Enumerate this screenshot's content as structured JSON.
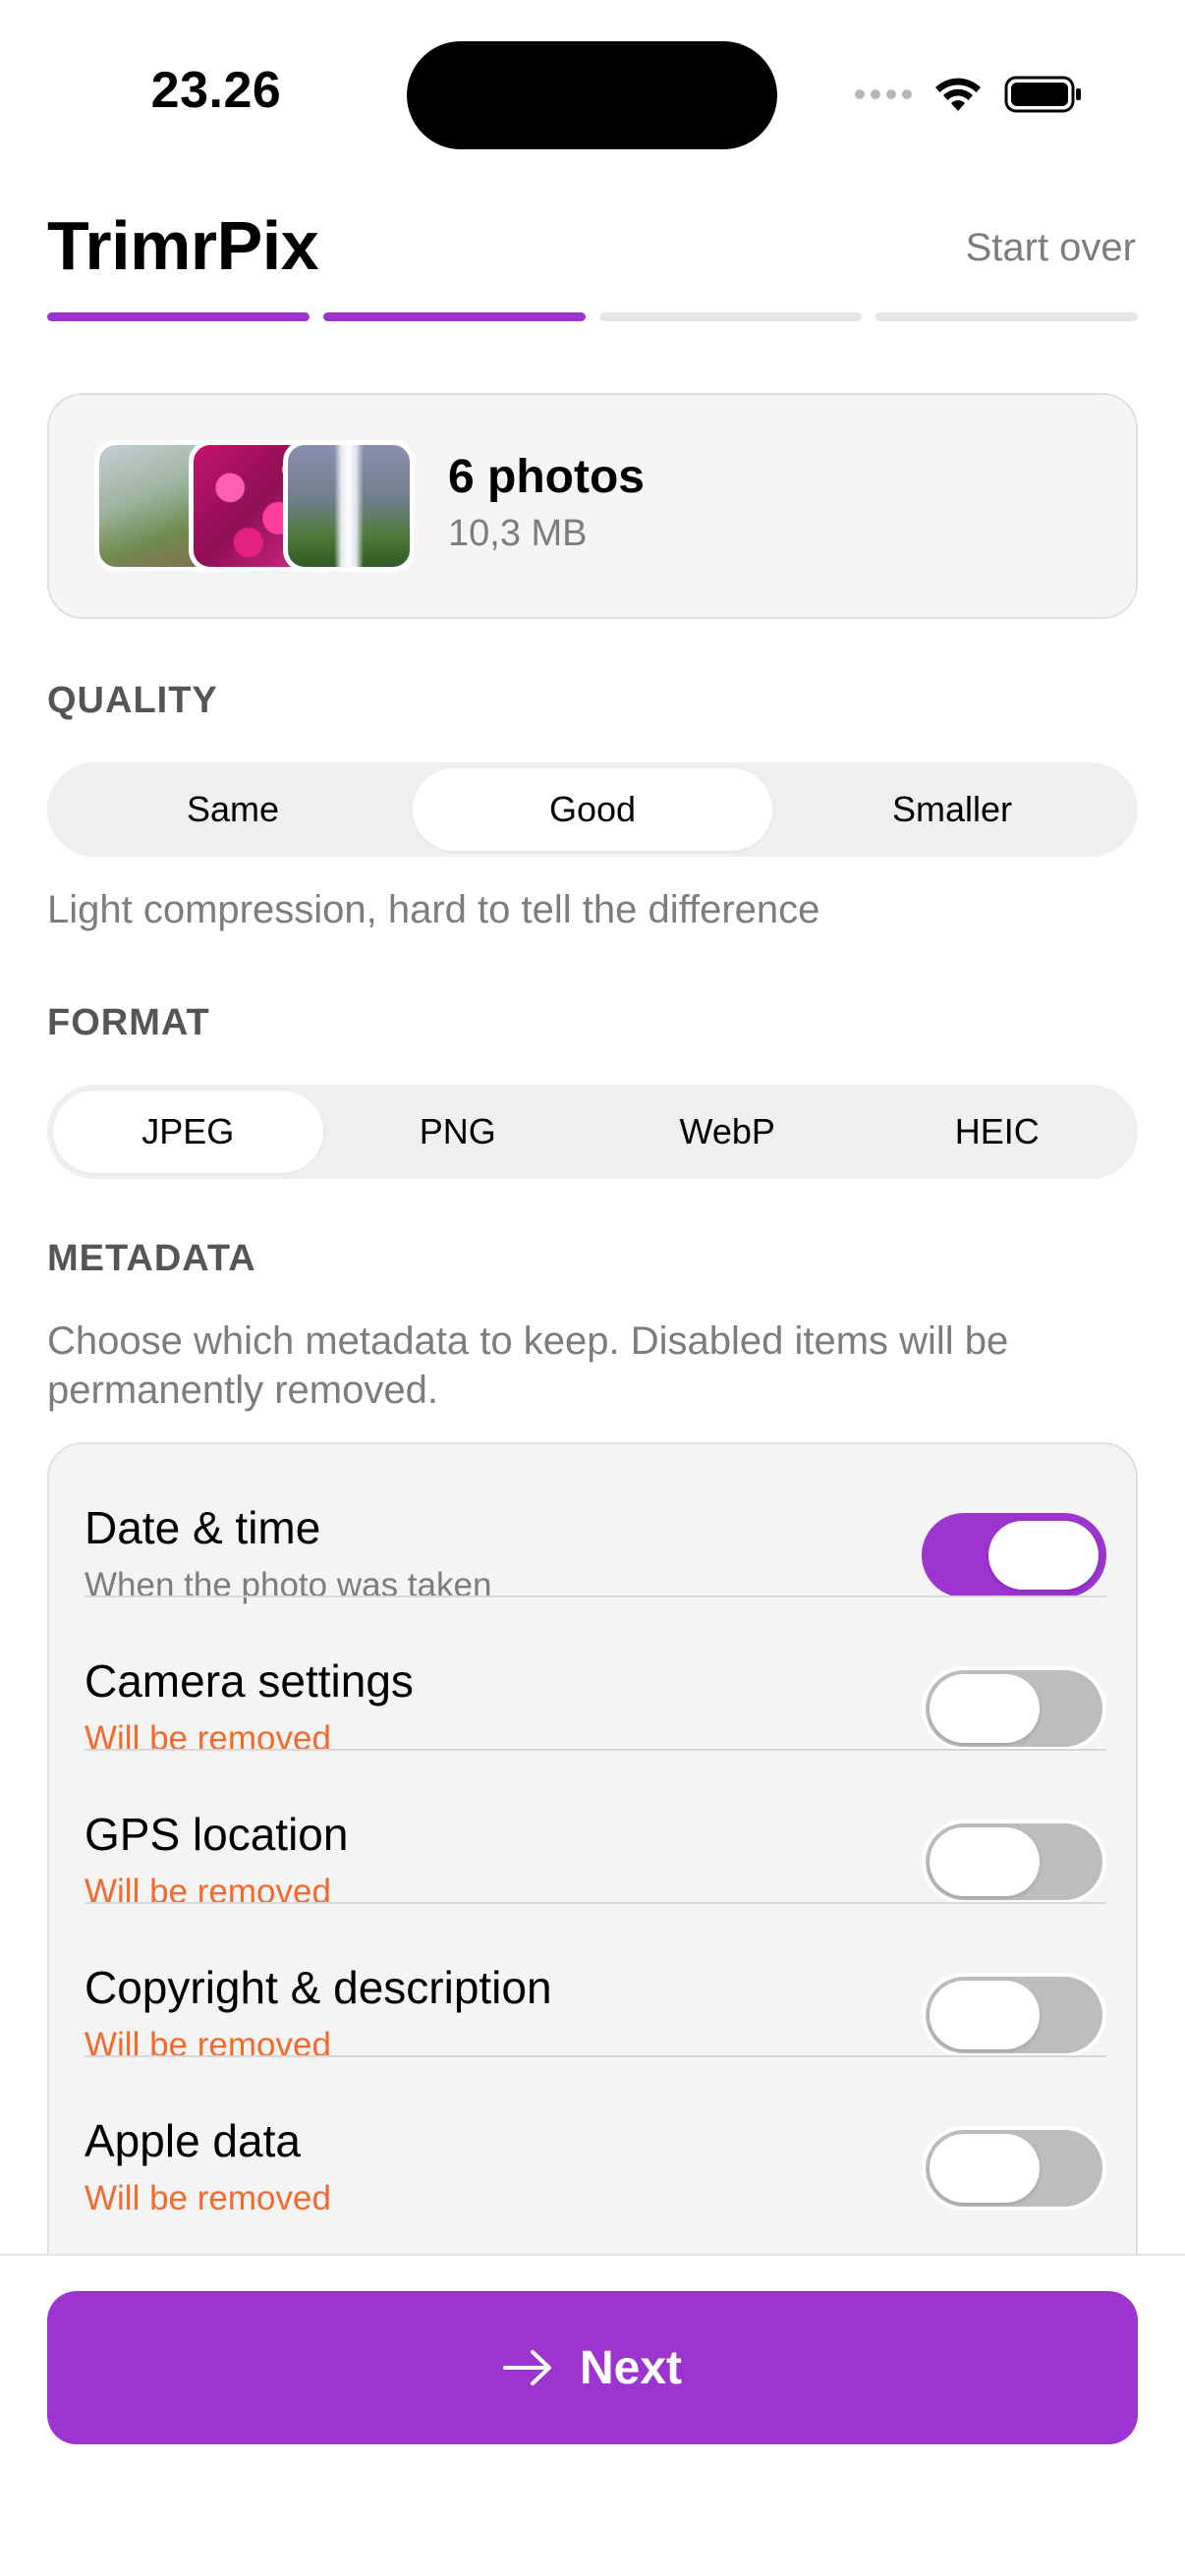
{
  "status_bar": {
    "time": "23.26",
    "icons": [
      "cellular-signal-icon",
      "wifi-icon",
      "battery-icon"
    ]
  },
  "header": {
    "title": "TrimrPix",
    "start_over_label": "Start over",
    "steps_total": 4,
    "steps_completed": 2
  },
  "photos": {
    "count_label": "6 photos",
    "size_label": "10,3 MB"
  },
  "quality": {
    "section_label": "QUALITY",
    "options": [
      "Same",
      "Good",
      "Smaller"
    ],
    "selected": "Good",
    "hint": "Light compression, hard to tell the difference"
  },
  "format": {
    "section_label": "FORMAT",
    "options": [
      "JPEG",
      "PNG",
      "WebP",
      "HEIC"
    ],
    "selected": "JPEG"
  },
  "metadata": {
    "section_label": "METADATA",
    "hint": "Choose which metadata to keep. Disabled items will be permanently removed.",
    "items": [
      {
        "title": "Date & time",
        "subtitle": "When the photo was taken",
        "enabled": true
      },
      {
        "title": "Camera settings",
        "subtitle": "Will be removed",
        "enabled": false
      },
      {
        "title": "GPS location",
        "subtitle": "Will be removed",
        "enabled": false
      },
      {
        "title": "Copyright & description",
        "subtitle": "Will be removed",
        "enabled": false
      },
      {
        "title": "Apple data",
        "subtitle": "Will be removed",
        "enabled": false
      }
    ]
  },
  "footer": {
    "next_label": "Next",
    "next_icon": "arrow-right-icon"
  },
  "colors": {
    "accent": "#9d34d0",
    "removed": "#f26a2e",
    "muted_text": "#7d7d7d"
  }
}
